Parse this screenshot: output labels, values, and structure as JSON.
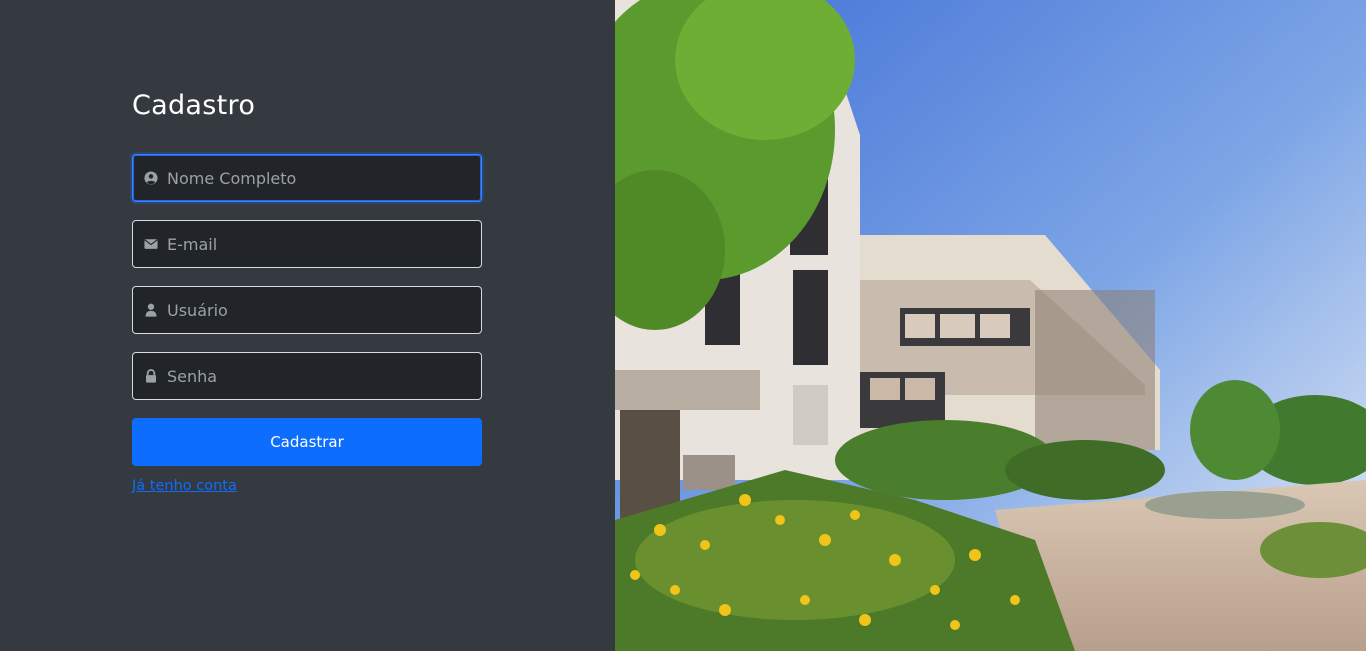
{
  "form": {
    "title": "Cadastro",
    "fields": [
      {
        "name": "nome",
        "placeholder": "Nome Completo",
        "icon": "user-circle-icon"
      },
      {
        "name": "email",
        "placeholder": "E-mail",
        "icon": "envelope-icon"
      },
      {
        "name": "usuario",
        "placeholder": "Usuário",
        "icon": "user-icon"
      },
      {
        "name": "senha",
        "placeholder": "Senha",
        "icon": "lock-icon"
      }
    ],
    "submit_label": "Cadastrar",
    "login_link": "Já tenho conta"
  },
  "colors": {
    "panel_bg": "#343a40",
    "input_bg": "#212529",
    "accent": "#0d6efd"
  },
  "hero_image": {
    "subject": "building-photo"
  }
}
